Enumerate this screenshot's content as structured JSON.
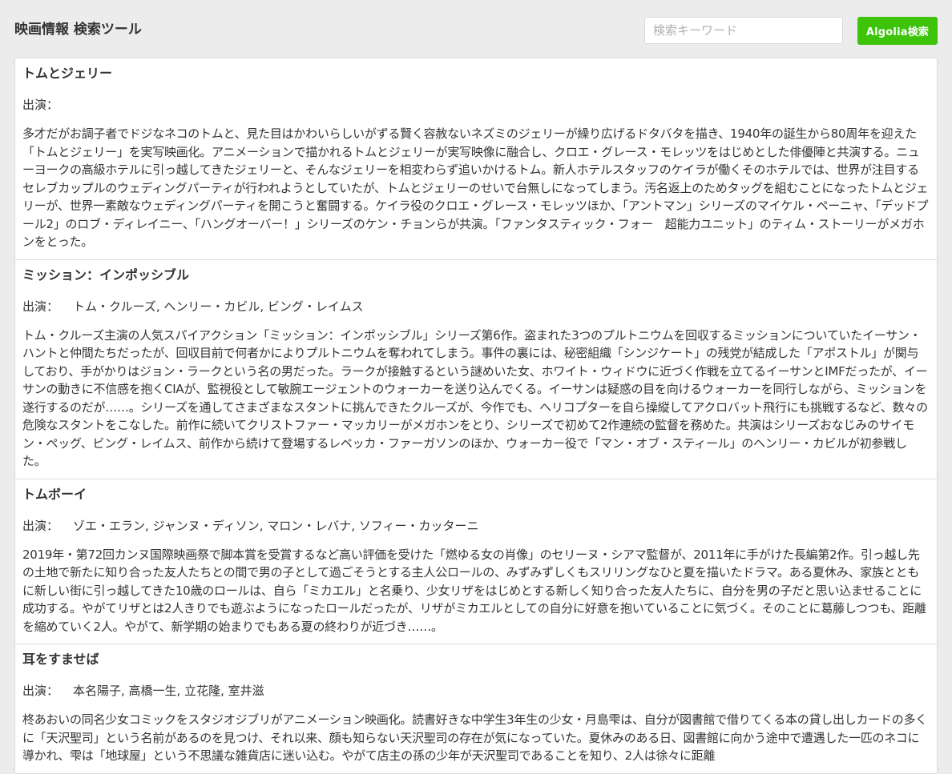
{
  "header": {
    "title": "映画情報 検索ツール",
    "search_placeholder": "検索キーワード",
    "search_value": "",
    "search_button_label": "Algolia検索",
    "accent_color": "#3cc30a"
  },
  "cast_label": "出演：",
  "movies": [
    {
      "title": "トムとジェリー",
      "cast": "",
      "synopsis": "多才だがお調子者でドジなネコのトムと、見た目はかわいらしいがずる賢く容赦ないネズミのジェリーが繰り広げるドタバタを描き、1940年の誕生から80周年を迎えた「トムとジェリー」を実写映画化。アニメーションで描かれるトムとジェリーが実写映像に融合し、クロエ・グレース・モレッツをはじめとした俳優陣と共演する。ニューヨークの高級ホテルに引っ越してきたジェリーと、そんなジェリーを相変わらず追いかけるトム。新人ホテルスタッフのケイラが働くそのホテルでは、世界が注目するセレブカップルのウェディングパーティが行われようとしていたが、トムとジェリーのせいで台無しになってしまう。汚名返上のためタッグを組むことになったトムとジェリーが、世界一素敵なウェディングパーティを開こうと奮闘する。ケイラ役のクロエ・グレース・モレッツほか、「アントマン」シリーズのマイケル・ペーニャ、「デッドプール2」のロブ・ディレイニー、「ハングオーバー！」シリーズのケン・チョンらが共演。「ファンタスティック・フォー　超能力ユニット」のティム・ストーリーがメガホンをとった。"
    },
    {
      "title": "ミッション：インポッシブル",
      "cast": "トム・クルーズ, ヘンリー・カビル, ビング・レイムス",
      "synopsis": "トム・クルーズ主演の人気スパイアクション「ミッション：インポッシブル」シリーズ第6作。盗まれた3つのプルトニウムを回収するミッションについていたイーサン・ハントと仲間たちだったが、回収目前で何者かによりプルトニウムを奪われてしまう。事件の裏には、秘密組織「シンジケート」の残党が結成した「アポストル」が関与しており、手がかりはジョン・ラークという名の男だった。ラークが接触するという謎めいた女、ホワイト・ウィドウに近づく作戦を立てるイーサンとIMFだったが、イーサンの動きに不信感を抱くCIAが、監視役として敏腕エージェントのウォーカーを送り込んでくる。イーサンは疑惑の目を向けるウォーカーを同行しながら、ミッションを遂行するのだが……。シリーズを通してさまざまなスタントに挑んできたクルーズが、今作でも、ヘリコプターを自ら操縦してアクロバット飛行にも挑戦するなど、数々の危険なスタントをこなした。前作に続いてクリストファー・マッカリーがメガホンをとり、シリーズで初めて2作連続の監督を務めた。共演はシリーズおなじみのサイモン・ペッグ、ビング・レイムス、前作から続けて登場するレベッカ・ファーガソンのほか、ウォーカー役で「マン・オブ・スティール」のヘンリー・カビルが初参戦した。"
    },
    {
      "title": "トムボーイ",
      "cast": "ゾエ・エラン, ジャンヌ・ディソン, マロン・レバナ, ソフィー・カッターニ",
      "synopsis": "2019年・第72回カンヌ国際映画祭で脚本賞を受賞するなど高い評価を受けた「燃ゆる女の肖像」のセリーヌ・シアマ監督が、2011年に手がけた長編第2作。引っ越し先の土地で新たに知り合った友人たちとの間で男の子として過ごそうとする主人公ロールの、みずみずしくもスリリングなひと夏を描いたドラマ。ある夏休み、家族とともに新しい街に引っ越してきた10歳のロールは、自ら「ミカエル」と名乗り、少女リザをはじめとする新しく知り合った友人たちに、自分を男の子だと思い込ませることに成功する。やがてリザとは2人きりでも遊ぶようになったロールだったが、リザがミカエルとしての自分に好意を抱いていることに気づく。そのことに葛藤しつつも、距離を縮めていく2人。やがて、新学期の始まりでもある夏の終わりが近づき……。"
    },
    {
      "title": "耳をすませば",
      "cast": "本名陽子, 高橋一生, 立花隆, 室井滋",
      "synopsis": "柊あおいの同名少女コミックをスタジオジブリがアニメーション映画化。読書好きな中学生3年生の少女・月島雫は、自分が図書館で借りてくる本の貸し出しカードの多くに「天沢聖司」という名前があるのを見つけ、それ以来、顔も知らない天沢聖司の存在が気になっていた。夏休みのある日、図書館に向かう途中で遭遇した一匹のネコに導かれ、雫は「地球屋」という不思議な雑貨店に迷い込む。やがて店主の孫の少年が天沢聖司であることを知り、2人は徐々に距離"
    }
  ]
}
